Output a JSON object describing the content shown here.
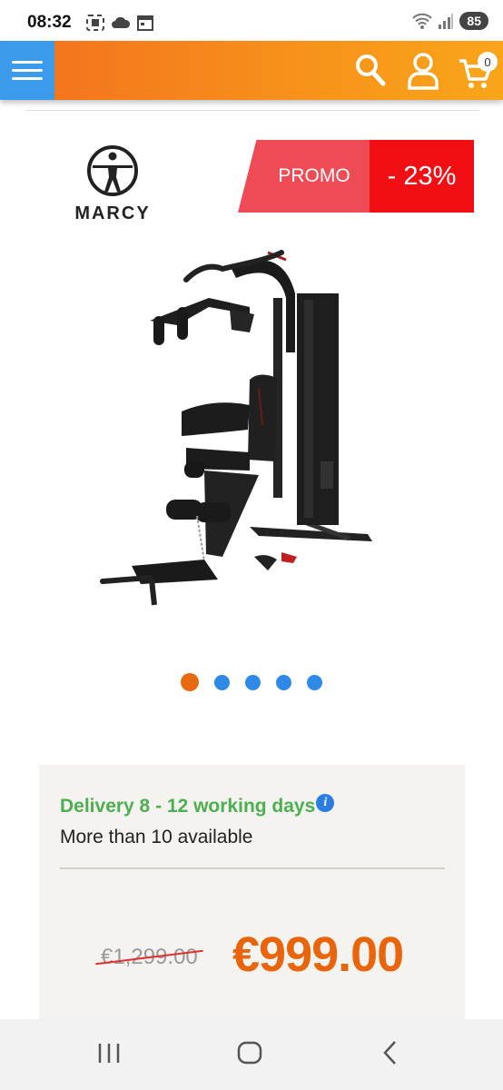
{
  "status_bar": {
    "time": "08:32",
    "battery": "85"
  },
  "header": {
    "cart_count": "0",
    "menu_icon": "hamburger-menu-icon",
    "search_icon": "search-icon",
    "account_icon": "user-icon",
    "cart_icon": "cart-icon",
    "colors": {
      "header_start": "#f26f1e",
      "header_end": "#f9a51a",
      "menu_bg": "#3b9bea"
    }
  },
  "product": {
    "brand": "MARCY",
    "promo_label": "PROMO",
    "discount": "- 23%",
    "image_icon": "home-gym-machine-image",
    "carousel": {
      "total": 5,
      "active_index": 0
    }
  },
  "availability": {
    "delivery": "Delivery 8 - 12 working days",
    "info_icon_glyph": "i",
    "stock": "More than 10 available"
  },
  "pricing": {
    "old_price": "€1,299.00",
    "new_price": "€999.00",
    "colors": {
      "new_price": "#e8650e",
      "delivery": "#4caf50"
    }
  },
  "nav_bar": {
    "recents_icon": "recent-apps-icon",
    "home_icon": "home-icon",
    "back_icon": "back-icon"
  }
}
